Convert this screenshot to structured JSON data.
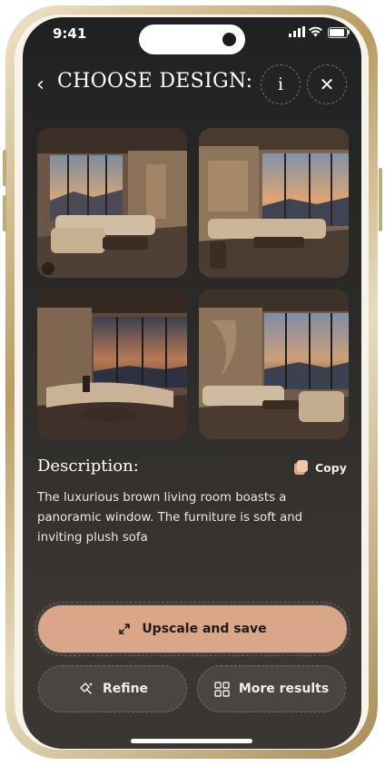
{
  "status_bar": {
    "time": "9:41"
  },
  "header": {
    "title": "CHOOSE DESIGN:",
    "info_label": "i"
  },
  "images": [
    {
      "alt": "Living room design 1"
    },
    {
      "alt": "Living room design 2"
    },
    {
      "alt": "Living room design 3"
    },
    {
      "alt": "Living room design 4"
    }
  ],
  "description": {
    "title": "Description:",
    "copy_label": "Copy",
    "text": "The luxurious brown living room boasts a panoramic window. The furniture is soft and inviting plush sofa"
  },
  "actions": {
    "upscale_label": "Upscale and save",
    "refine_label": "Refine",
    "more_label": "More results"
  },
  "colors": {
    "accent": "#d9a68a",
    "background": "#2c2b29",
    "frame": "#c2a978"
  }
}
